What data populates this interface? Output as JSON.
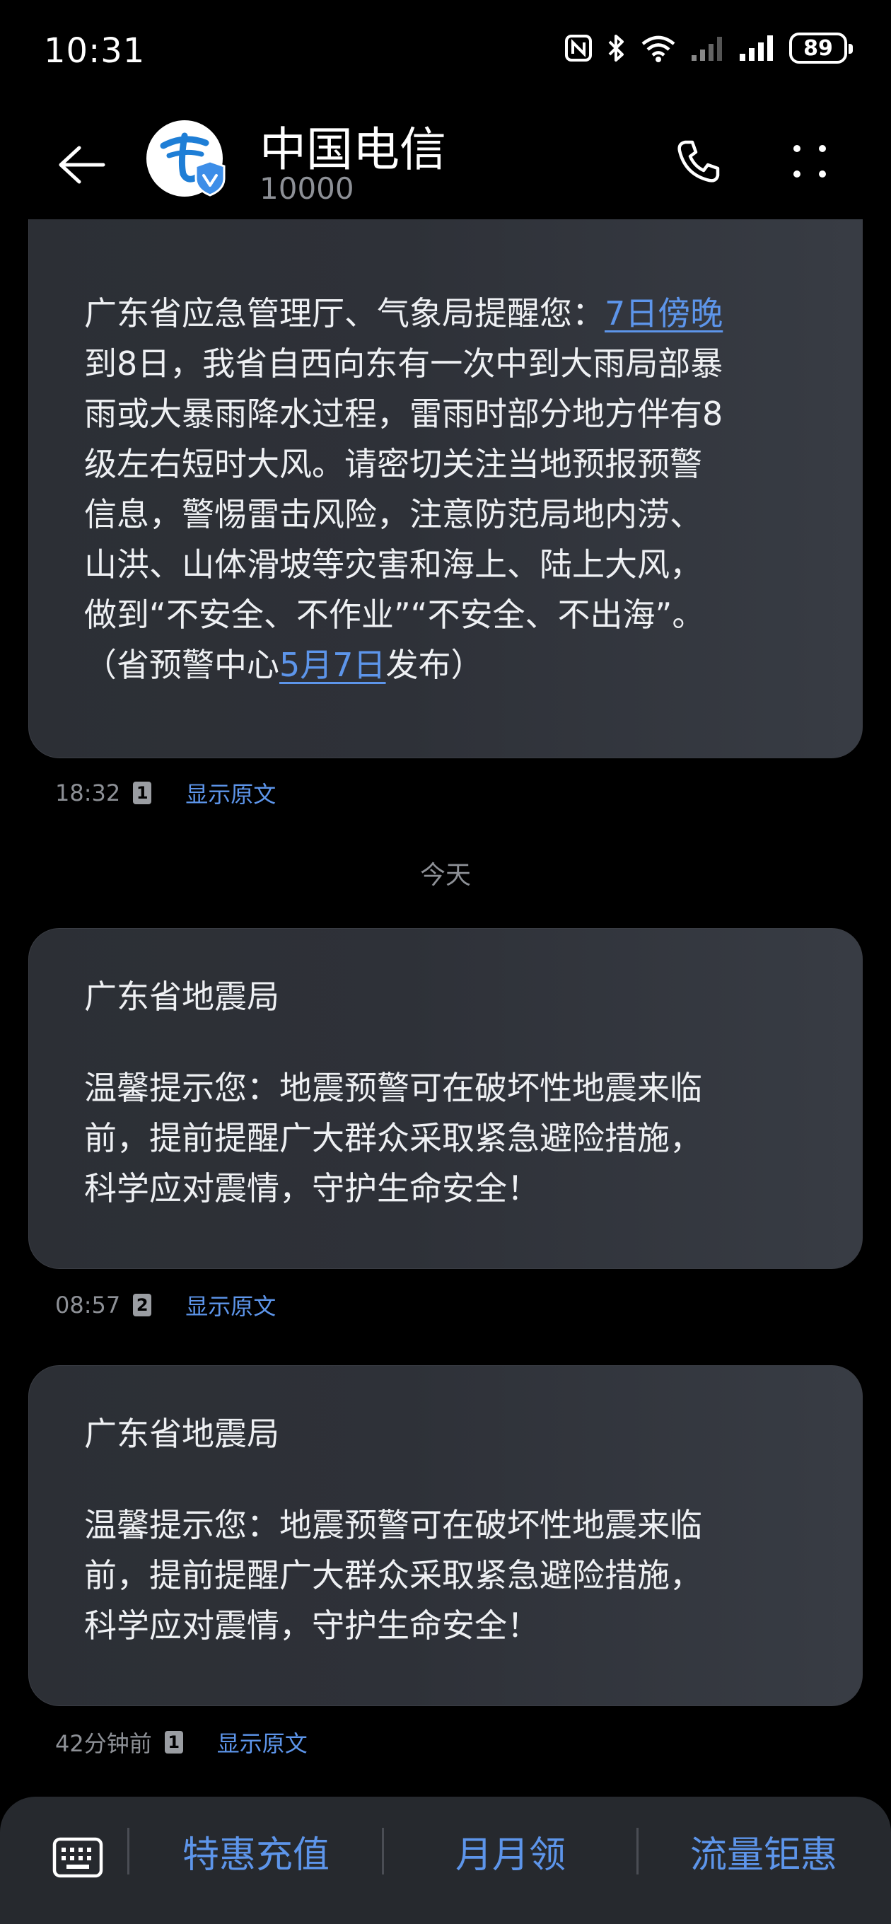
{
  "status_bar": {
    "time": "10:31",
    "battery": "89",
    "icons": [
      "nfc-icon",
      "bluetooth-icon",
      "wifi-icon",
      "signal-sim2-icon",
      "signal-sim1-icon",
      "battery-icon"
    ]
  },
  "header": {
    "contact_name": "中国电信",
    "contact_number": "10000",
    "icons": [
      "back-arrow-icon",
      "china-telecom-logo",
      "verified-badge-icon",
      "phone-icon",
      "more-dots-icon"
    ]
  },
  "messages": [
    {
      "lines": [
        [
          "广东省应急管理厅、气象局提醒您：",
          "7日傍晚"
        ],
        [
          "到8日，我省自西向东有一次中到大雨局部暴"
        ],
        [
          "雨或大暴雨降水过程，雷雨时部分地方伴有8"
        ],
        [
          "级左右短时大风。请密切关注当地预报预警"
        ],
        [
          "信息，警惕雷击风险，注意防范局地内涝、"
        ],
        [
          "山洪、山体滑坡等灾害和海上、陆上大风，"
        ],
        [
          "做到“不安全、不作业”“不安全、不出海”。"
        ],
        [
          "（省预警中心",
          "5月7日",
          "发布）"
        ]
      ],
      "time": "18:32",
      "sim": "1",
      "action": "显示原文"
    },
    {
      "sender": "广东省地震局",
      "lines": [
        "温馨提示您：地震预警可在破坏性地震来临",
        "前，提前提醒广大群众采取紧急避险措施，",
        "科学应对震情，守护生命安全！"
      ],
      "time": "08:57",
      "sim": "2",
      "action": "显示原文"
    },
    {
      "sender": "广东省地震局",
      "lines": [
        "温馨提示您：地震预警可在破坏性地震来临",
        "前，提前提醒广大群众采取紧急避险措施，",
        "科学应对震情，守护生命安全！"
      ],
      "time": "42分钟前",
      "sim": "1",
      "action": "显示原文"
    }
  ],
  "date_divider": "今天",
  "bottom_bar": {
    "actions": [
      "特惠充值",
      "月月领",
      "流量钜惠"
    ],
    "icon": "keyboard-icon"
  },
  "colors": {
    "background": "#000000",
    "bubble": "#2e3138",
    "link": "#5d95ea",
    "muted": "#8d9096"
  }
}
